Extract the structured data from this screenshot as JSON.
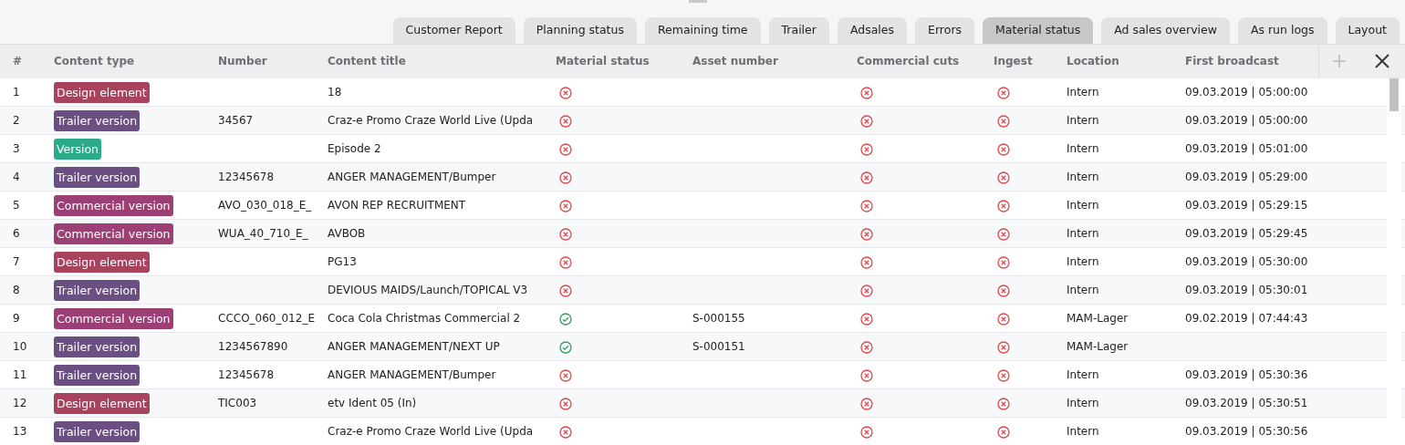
{
  "tabs": [
    {
      "label": "Customer Report",
      "selected": false
    },
    {
      "label": "Planning status",
      "selected": false
    },
    {
      "label": "Remaining time",
      "selected": false
    },
    {
      "label": "Trailer",
      "selected": false
    },
    {
      "label": "Adsales",
      "selected": false
    },
    {
      "label": "Errors",
      "selected": false
    },
    {
      "label": "Material status",
      "selected": true
    },
    {
      "label": "Ad sales overview",
      "selected": false
    },
    {
      "label": "As run logs",
      "selected": false
    },
    {
      "label": "Layout",
      "selected": false
    }
  ],
  "table": {
    "columns": [
      "#",
      "Content type",
      "Number",
      "Content title",
      "Material status",
      "Asset number",
      "Commercial cuts",
      "Ingest",
      "Location",
      "First broadcast"
    ],
    "rows": [
      {
        "index": "1",
        "type": {
          "label": "Design element",
          "color": "#a8435e"
        },
        "number": "",
        "title": "18",
        "material_ok": false,
        "asset": "",
        "cuts_ok": false,
        "ingest_ok": false,
        "location": "Intern",
        "broadcast": "09.03.2019 | 05:00:00"
      },
      {
        "index": "2",
        "type": {
          "label": "Trailer version",
          "color": "#6b4f82"
        },
        "number": "34567",
        "title": "Craz-e Promo Craze World Live (Upda",
        "material_ok": false,
        "asset": "",
        "cuts_ok": false,
        "ingest_ok": false,
        "location": "Intern",
        "broadcast": "09.03.2019 | 05:00:00"
      },
      {
        "index": "3",
        "type": {
          "label": "Version",
          "color": "#2bab8a"
        },
        "number": "",
        "title": "Episode 2",
        "material_ok": false,
        "asset": "",
        "cuts_ok": false,
        "ingest_ok": false,
        "location": "Intern",
        "broadcast": "09.03.2019 | 05:01:00"
      },
      {
        "index": "4",
        "type": {
          "label": "Trailer version",
          "color": "#6b4f82"
        },
        "number": "12345678",
        "title": "ANGER MANAGEMENT/Bumper",
        "material_ok": false,
        "asset": "",
        "cuts_ok": false,
        "ingest_ok": false,
        "location": "Intern",
        "broadcast": "09.03.2019 | 05:29:00"
      },
      {
        "index": "5",
        "type": {
          "label": "Commercial version",
          "color": "#9b3f74"
        },
        "number": "AVO_030_018_E_",
        "title": "AVON REP RECRUITMENT",
        "material_ok": false,
        "asset": "",
        "cuts_ok": false,
        "ingest_ok": false,
        "location": "Intern",
        "broadcast": "09.03.2019 | 05:29:15"
      },
      {
        "index": "6",
        "type": {
          "label": "Commercial version",
          "color": "#9b3f74"
        },
        "number": "WUA_40_710_E_",
        "title": "AVBOB",
        "material_ok": false,
        "asset": "",
        "cuts_ok": false,
        "ingest_ok": false,
        "location": "Intern",
        "broadcast": "09.03.2019 | 05:29:45"
      },
      {
        "index": "7",
        "type": {
          "label": "Design element",
          "color": "#a8435e"
        },
        "number": "",
        "title": "PG13",
        "material_ok": false,
        "asset": "",
        "cuts_ok": false,
        "ingest_ok": false,
        "location": "Intern",
        "broadcast": "09.03.2019 | 05:30:00"
      },
      {
        "index": "8",
        "type": {
          "label": "Trailer version",
          "color": "#6b4f82"
        },
        "number": "",
        "title": "DEVIOUS MAIDS/Launch/TOPICAL V3",
        "material_ok": false,
        "asset": "",
        "cuts_ok": false,
        "ingest_ok": false,
        "location": "Intern",
        "broadcast": "09.03.2019 | 05:30:01"
      },
      {
        "index": "9",
        "type": {
          "label": "Commercial version",
          "color": "#9b3f74"
        },
        "number": "CCCO_060_012_E",
        "title": "Coca Cola Christmas Commercial 2",
        "material_ok": true,
        "asset": "S-000155",
        "cuts_ok": false,
        "ingest_ok": false,
        "location": "MAM-Lager",
        "broadcast": "09.02.2019 | 07:44:43"
      },
      {
        "index": "10",
        "type": {
          "label": "Trailer version",
          "color": "#6b4f82"
        },
        "number": "1234567890",
        "title": "ANGER MANAGEMENT/NEXT UP",
        "material_ok": true,
        "asset": "S-000151",
        "cuts_ok": false,
        "ingest_ok": false,
        "location": "MAM-Lager",
        "broadcast": ""
      },
      {
        "index": "11",
        "type": {
          "label": "Trailer version",
          "color": "#6b4f82"
        },
        "number": "12345678",
        "title": "ANGER MANAGEMENT/Bumper",
        "material_ok": false,
        "asset": "",
        "cuts_ok": false,
        "ingest_ok": false,
        "location": "Intern",
        "broadcast": "09.03.2019 | 05:30:36"
      },
      {
        "index": "12",
        "type": {
          "label": "Design element",
          "color": "#a8435e"
        },
        "number": "TIC003",
        "title": "etv Ident 05 (In)",
        "material_ok": false,
        "asset": "",
        "cuts_ok": false,
        "ingest_ok": false,
        "location": "Intern",
        "broadcast": "09.03.2019 | 05:30:51"
      },
      {
        "index": "13",
        "type": {
          "label": "Trailer version",
          "color": "#6b4f82"
        },
        "number": "",
        "title": "Craz-e Promo Craze World Live (Upda",
        "material_ok": false,
        "asset": "",
        "cuts_ok": false,
        "ingest_ok": false,
        "location": "Intern",
        "broadcast": "09.03.2019 | 05:30:56"
      }
    ]
  }
}
